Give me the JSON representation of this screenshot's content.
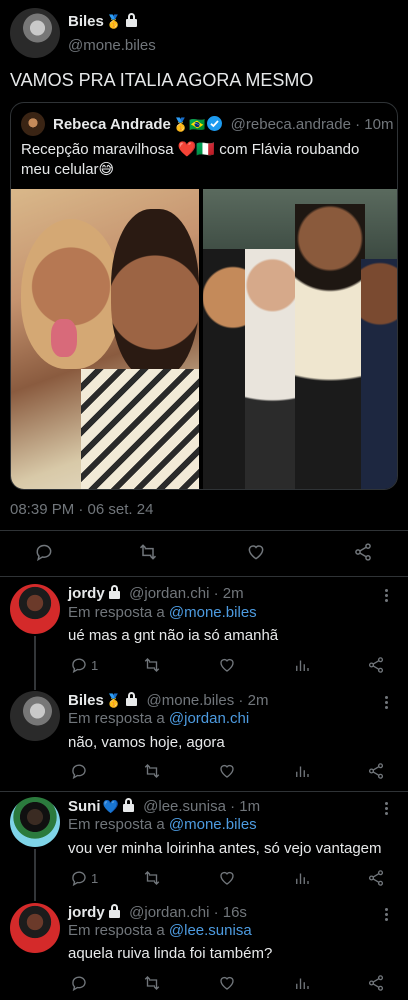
{
  "main_tweet": {
    "name": "Biles",
    "name_emoji": "🥇",
    "handle": "@mone.biles",
    "text": "VAMOS PRA ITALIA AGORA MESMO",
    "timestamp": "08:39 PM · 06 set. 24"
  },
  "quoted_tweet": {
    "name": "Rebeca Andrade",
    "name_emoji": "🥇🇧🇷",
    "handle_time": "@rebeca.andrade · 10m",
    "text_line1": "Recepção maravilhosa ❤️🇮🇹 com Flávia roubando",
    "text_line2": "meu celular😅"
  },
  "replies": [
    {
      "name": "jordy",
      "handle_time": "@jordan.chi · 2m",
      "reply_prefix": "Em resposta a",
      "reply_to": "@mone.biles",
      "text": "ué mas a gnt não ia só amanhã",
      "reply_count": "1"
    },
    {
      "name": "Biles",
      "name_emoji": "🥇",
      "handle_time": "@mone.biles · 2m",
      "reply_prefix": "Em resposta a",
      "reply_to": "@jordan.chi",
      "text": "não, vamos hoje, agora",
      "reply_count": ""
    },
    {
      "name": "Suni",
      "name_emoji": "💙",
      "handle_time": "@lee.sunisa · 1m",
      "reply_prefix": "Em resposta a",
      "reply_to": "@mone.biles",
      "text": "vou ver minha loirinha antes, só vejo vantagem",
      "reply_count": "1"
    },
    {
      "name": "jordy",
      "handle_time": "@jordan.chi · 16s",
      "reply_prefix": "Em resposta a",
      "reply_to": "@lee.sunisa",
      "text": "aquela ruiva linda foi também?",
      "reply_count": ""
    }
  ],
  "colors": {
    "background": "#000000",
    "text": "#e7e9ea",
    "secondary": "#71767b",
    "link": "#4d9be0",
    "heart": "#e0245e"
  }
}
